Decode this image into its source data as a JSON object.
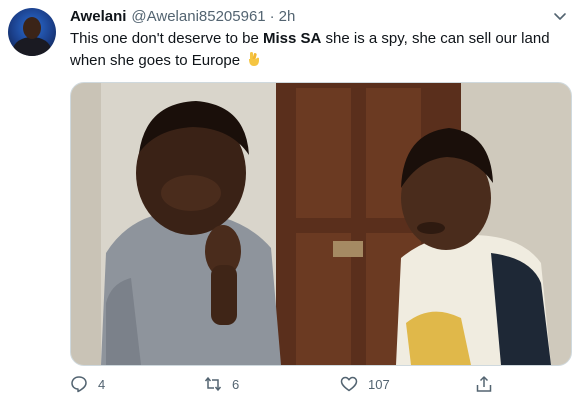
{
  "author": {
    "name": "Awelani",
    "handle": "@Awelani85205961",
    "separator": "·",
    "time": "2h"
  },
  "tweet": {
    "text_before": "This one don't deserve to be ",
    "text_bold": "Miss SA",
    "text_after": " she is a spy, she can sell our land when she goes to Europe",
    "emoji": "crossed-fingers-emoji"
  },
  "actions": {
    "reply_count": "4",
    "retweet_count": "6",
    "like_count": "107"
  },
  "icons": {
    "caret": "chevron-down-icon",
    "reply": "reply-icon",
    "retweet": "retweet-icon",
    "like": "heart-icon",
    "share": "share-icon"
  },
  "colors": {
    "text": "#0f1419",
    "muted": "#536471",
    "border": "#cfd9de"
  }
}
